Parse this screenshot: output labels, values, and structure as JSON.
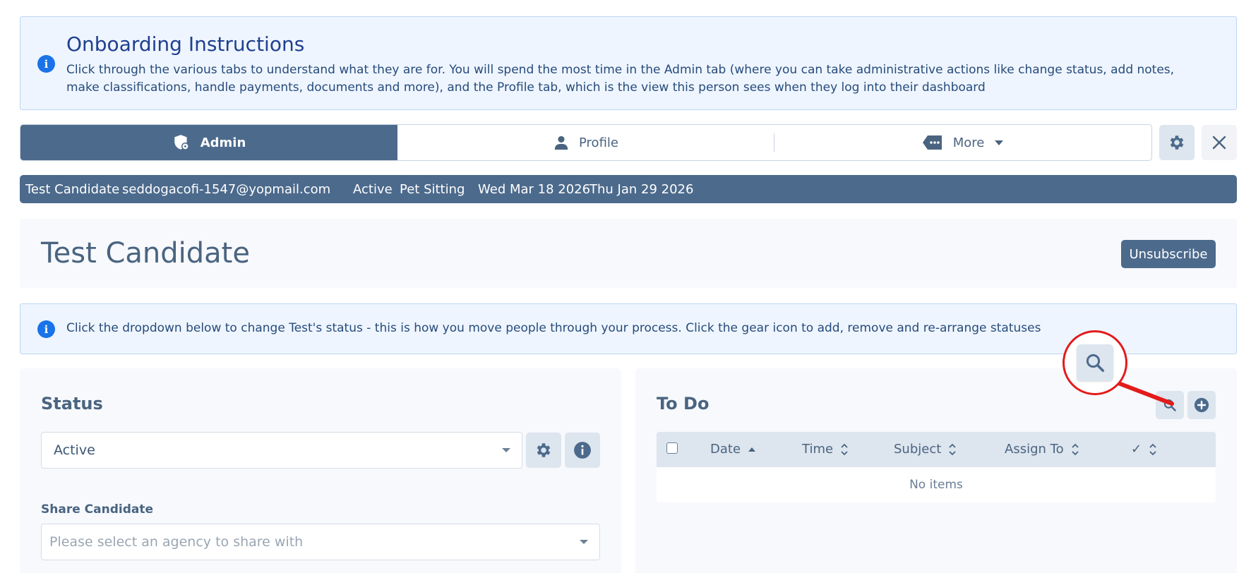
{
  "onboarding": {
    "title": "Onboarding Instructions",
    "body": "Click through the various tabs to understand what they are for. You will spend the most time in the Admin tab (where you can take administrative actions like change status, add notes, make classifications, handle payments, documents and more), and the Profile tab, which is the view this person sees when they log into their dashboard"
  },
  "tabs": {
    "admin": "Admin",
    "profile": "Profile",
    "more": "More"
  },
  "strip": {
    "name": "Test Candidate",
    "email": "seddogacofi-1547@yopmail.com",
    "status": "Active",
    "category": "Pet Sitting",
    "date1": "Wed Mar 18 2026",
    "date2": "Thu Jan 29 2026"
  },
  "header": {
    "title": "Test Candidate",
    "unsubscribe": "Unsubscribe"
  },
  "status_info": {
    "text": "Click the dropdown below to change Test's status - this is how you move people through your process. Click the gear icon to add, remove and re-arrange statuses"
  },
  "status_card": {
    "title": "Status",
    "selected": "Active",
    "share_label": "Share Candidate",
    "share_placeholder": "Please select an agency to share with"
  },
  "todo": {
    "title": "To Do",
    "columns": [
      "Date",
      "Time",
      "Subject",
      "Assign To",
      "✓"
    ],
    "empty": "No items"
  },
  "colors": {
    "primary": "#4c6a8c",
    "info_blue": "#1a73e8",
    "banner_bg": "#eef5ff",
    "highlight_red": "#e21b1b"
  }
}
